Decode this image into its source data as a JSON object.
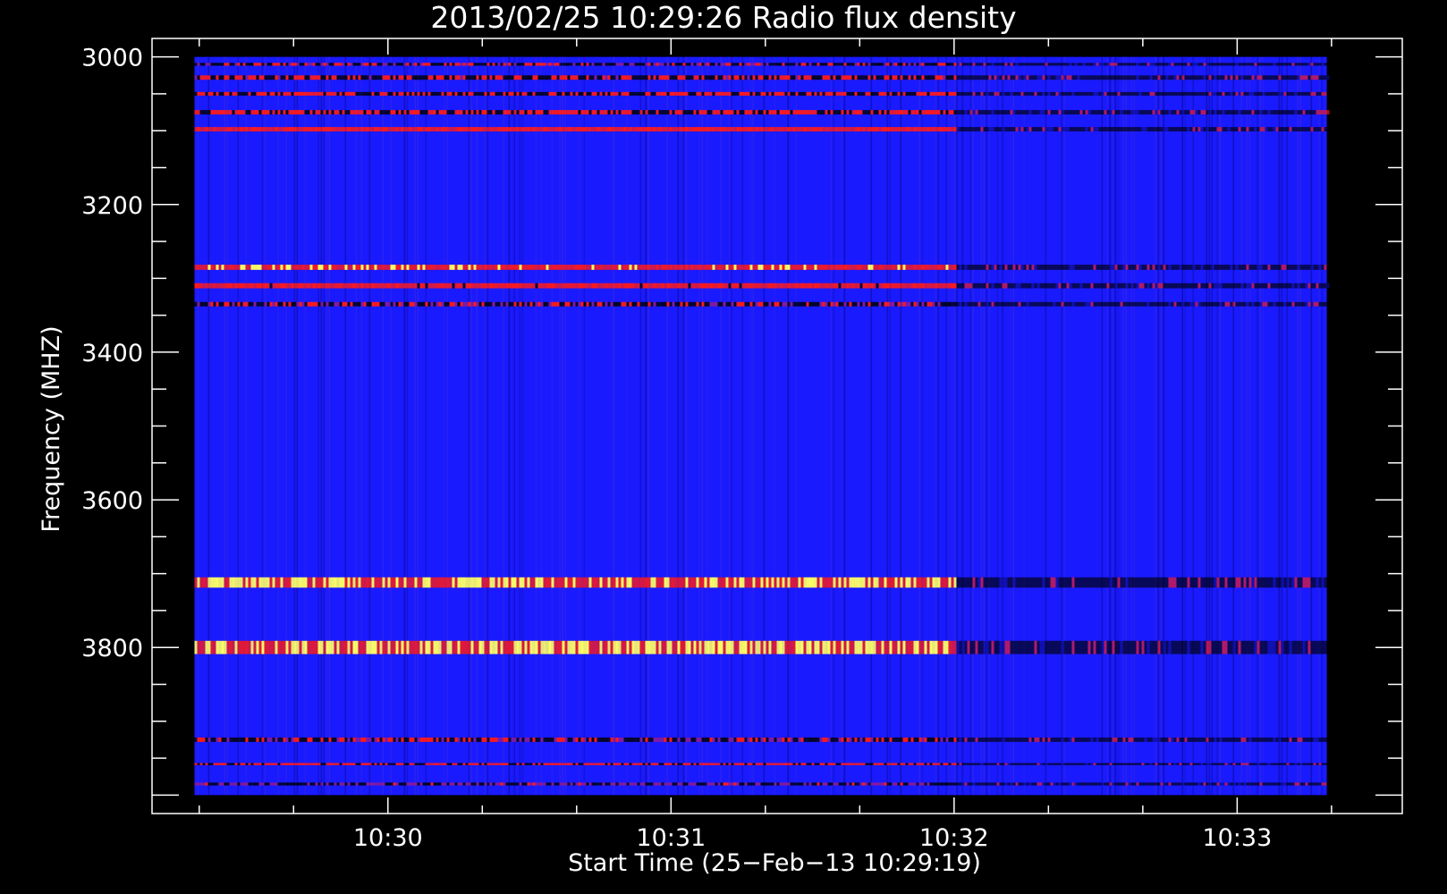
{
  "chart_data": {
    "type": "heatmap",
    "title": "2013/02/25 10:29:26 Radio flux density",
    "xlabel": "Start Time (25−Feb−13 10:29:19)",
    "ylabel": "Frequency (MHZ)",
    "x_axis": {
      "unit": "time",
      "range": [
        "10:29:10",
        "10:33:35"
      ],
      "data_range": [
        "10:29:19",
        "10:33:19"
      ],
      "major_ticks": [
        "10:30",
        "10:31",
        "10:32",
        "10:33"
      ],
      "minor_tick_interval_s": 20
    },
    "y_axis": {
      "unit": "MHz",
      "inverted": true,
      "range": [
        2975,
        4025
      ],
      "data_range": [
        3000,
        4000
      ],
      "major_ticks": [
        3000,
        3200,
        3400,
        3600,
        3800
      ],
      "minor_tick_interval": 50
    },
    "colormap": {
      "background": "#1a1aff",
      "low": "#000000",
      "mid": "#ff1a1a",
      "high": "#ffff66"
    },
    "bands": [
      {
        "freq": 3010,
        "width": 4,
        "intensity": 0.35,
        "quiet_after": "10:32:00"
      },
      {
        "freq": 3028,
        "width": 6,
        "intensity": 0.4,
        "quiet_after": "10:32:00"
      },
      {
        "freq": 3050,
        "width": 5,
        "intensity": 0.45,
        "quiet_after": "10:32:00"
      },
      {
        "freq": 3075,
        "width": 6,
        "intensity": 0.45,
        "quiet_after": "10:32:00"
      },
      {
        "freq": 3098,
        "width": 6,
        "intensity": 0.7,
        "quiet_after": "10:32:00"
      },
      {
        "freq": 3285,
        "width": 7,
        "intensity": 0.8,
        "quiet_after": "10:32:00"
      },
      {
        "freq": 3310,
        "width": 7,
        "intensity": 0.65,
        "quiet_after": "10:32:00"
      },
      {
        "freq": 3335,
        "width": 6,
        "intensity": 0.35,
        "quiet_after": "10:32:00"
      },
      {
        "freq": 3712,
        "width": 14,
        "intensity": 0.95,
        "quiet_after": "10:32:00"
      },
      {
        "freq": 3800,
        "width": 18,
        "intensity": 1.0,
        "quiet_after": "10:32:00"
      },
      {
        "freq": 3925,
        "width": 6,
        "intensity": 0.35,
        "quiet_after": "10:32:00"
      },
      {
        "freq": 3958,
        "width": 3,
        "intensity": 0.5,
        "quiet_after": "10:32:00"
      },
      {
        "freq": 3985,
        "width": 4,
        "intensity": 0.3,
        "quiet_after": "10:32:00"
      }
    ]
  }
}
